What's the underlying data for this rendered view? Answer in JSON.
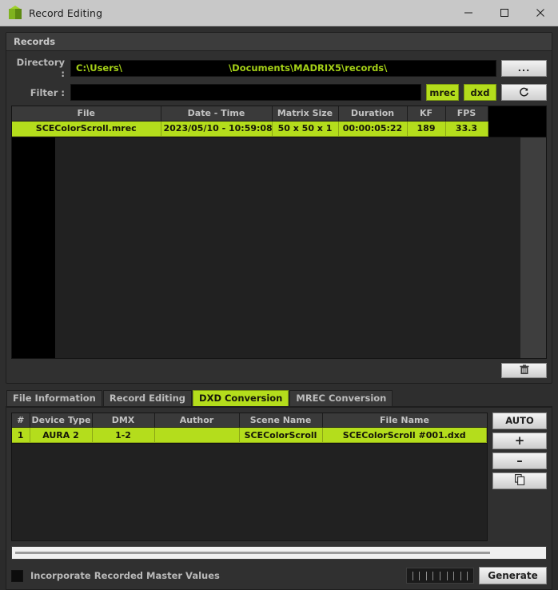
{
  "window": {
    "title": "Record Editing",
    "icon": "madrix-cube-icon",
    "controls": {
      "minimize": "minimize-icon",
      "maximize": "maximize-icon",
      "close": "close-icon"
    }
  },
  "records_group": {
    "title": "Records",
    "directory": {
      "label": "Directory :",
      "value_prefix": "C:\\Users\\",
      "value_suffix": "\\Documents\\MADRIX5\\records\\",
      "browse_label": "..."
    },
    "filter": {
      "label": "Filter :",
      "value": "",
      "placeholder": "",
      "mrec_label": "mrec",
      "dxd_label": "dxd",
      "refresh_icon": "refresh-icon"
    },
    "table": {
      "columns": [
        "File",
        "Date - Time",
        "Matrix Size",
        "Duration",
        "KF",
        "FPS"
      ],
      "rows": [
        {
          "File": "SCEColorScroll.mrec",
          "Date - Time": "2023/05/10 - 10:59:08",
          "Matrix Size": "50 x 50 x 1",
          "Duration": "00:00:05:22",
          "KF": "189",
          "FPS": "33.3"
        }
      ]
    },
    "delete_icon": "trash-icon"
  },
  "tabs": [
    {
      "label": "File Information",
      "active": false
    },
    {
      "label": "Record Editing",
      "active": false
    },
    {
      "label": "DXD Conversion",
      "active": true
    },
    {
      "label": "MREC Conversion",
      "active": false
    }
  ],
  "conversion": {
    "table": {
      "columns": [
        "#",
        "Device Type",
        "DMX",
        "Author",
        "Scene Name",
        "File Name"
      ],
      "rows": [
        {
          "#": "1",
          "Device Type": "AURA 2",
          "DMX": "1-2",
          "Author": "",
          "Scene Name": "SCEColorScroll",
          "File Name": "SCEColorScroll #001.dxd"
        }
      ]
    },
    "side_buttons": [
      {
        "label": "AUTO",
        "name": "auto-button"
      },
      {
        "label": "+",
        "name": "add-button"
      },
      {
        "label": "–",
        "name": "remove-button"
      },
      {
        "label": "",
        "name": "duplicate-button",
        "icon": "copy-icon"
      }
    ]
  },
  "footer": {
    "checkbox_label": "Incorporate Recorded Master Values",
    "checkbox_checked": false,
    "progress_ticks": 9,
    "generate_label": "Generate"
  },
  "colors": {
    "accent_green": "#b4dd1c",
    "panel_bg": "#303030",
    "window_bg": "#2e2e2e",
    "titlebar_bg": "#c8c8c8",
    "field_bg": "#000000",
    "header_bg": "#3a3a3a"
  }
}
